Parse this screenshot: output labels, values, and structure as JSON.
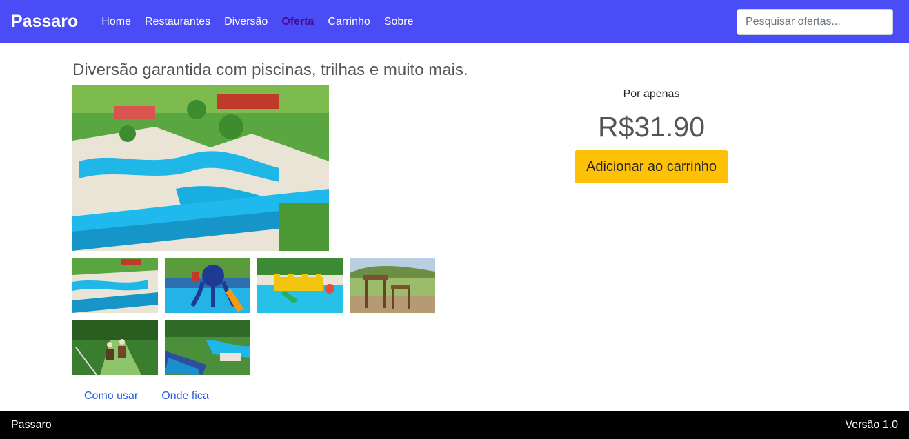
{
  "navbar": {
    "brand": "Passaro",
    "links": [
      {
        "label": "Home",
        "active": false
      },
      {
        "label": "Restaurantes",
        "active": false
      },
      {
        "label": "Diversão",
        "active": false
      },
      {
        "label": "Oferta",
        "active": true
      },
      {
        "label": "Carrinho",
        "active": false
      },
      {
        "label": "Sobre",
        "active": false
      }
    ],
    "search_placeholder": "Pesquisar ofertas..."
  },
  "offer": {
    "headline": "Diversão garantida com piscinas, trilhas e muito mais.",
    "main_image": "water-park-pools-photo",
    "thumbnails": [
      "water-park-aerial-photo",
      "octopus-slide-pool-photo",
      "inflatable-castle-pool-photo",
      "wooden-playground-photo",
      "horseback-trail-photo",
      "water-slide-park-photo"
    ],
    "price_label": "Por apenas",
    "price": "R$31.90",
    "cart_button": "Adicionar ao carrinho"
  },
  "tabs": [
    "Como usar",
    "Onde fica"
  ],
  "footer": {
    "left": "Passaro",
    "right": "Versão 1.0"
  },
  "colors": {
    "navbar": "#4a4cf5",
    "active_link": "#4b0b8f",
    "cart_button": "#ffc107",
    "tab_link": "#2a5ae8",
    "footer": "#000000"
  }
}
